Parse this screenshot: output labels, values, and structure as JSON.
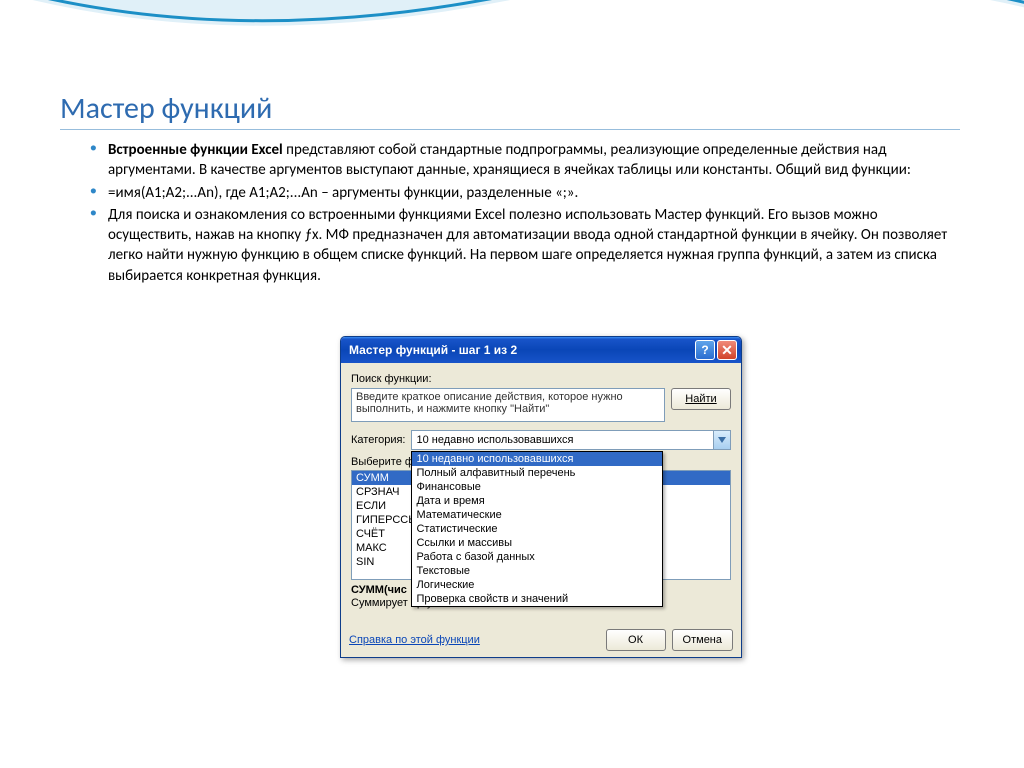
{
  "slide": {
    "title": "Мастер функций",
    "bullets": [
      {
        "bold": "Встроенные функции Excel",
        "text": " представляют собой стандартные подпрограммы, реализующие определенные действия над аргументами. В качестве аргументов выступают данные, хранящиеся в ячейках таблицы или константы.  Общий вид функции:"
      },
      {
        "text": "=имя(A1;A2;...An),  где A1;A2;...An  – аргументы функции, разделенные «;»."
      },
      {
        "text": "Для поиска и ознакомления со встроенными функциями Excel  полезно использовать Мастер функций. Его вызов можно осуществить, нажав на кнопку ƒx. МФ предназначен для автоматизации ввода одной стандартной функции в ячейку. Он позволяет легко найти нужную функцию в общем списке функций.  На первом шаге определяется нужная группа функций, а затем из списка выбирается конкретная функция."
      }
    ]
  },
  "dialog": {
    "title": "Мастер функций - шаг 1 из 2",
    "help_glyph": "?",
    "close_glyph": "✕",
    "search_label": "Поиск функции:",
    "search_placeholder": "Введите краткое описание действия, которое нужно выполнить, и нажмите кнопку \"Найти\"",
    "find_button": "Найти",
    "category_label": "Категория:",
    "category_value": "10 недавно использовавшихся",
    "dropdown_items": [
      "10 недавно использовавшихся",
      "Полный алфавитный перечень",
      "Финансовые",
      "Дата и время",
      "Математические",
      "Статистические",
      "Ссылки и массивы",
      "Работа с базой данных",
      "Текстовые",
      "Логические",
      "Проверка свойств и значений"
    ],
    "select_label": "Выберите фу",
    "functions": [
      "СУММ",
      "СРЗНАЧ",
      "ЕСЛИ",
      "ГИПЕРССЫ",
      "СЧЁТ",
      "МАКС",
      "SIN"
    ],
    "signature": "СУММ(чис",
    "description": "Суммирует аргументы.",
    "help_link": "Справка по этой функции",
    "ok": "ОК",
    "cancel": "Отмена"
  }
}
